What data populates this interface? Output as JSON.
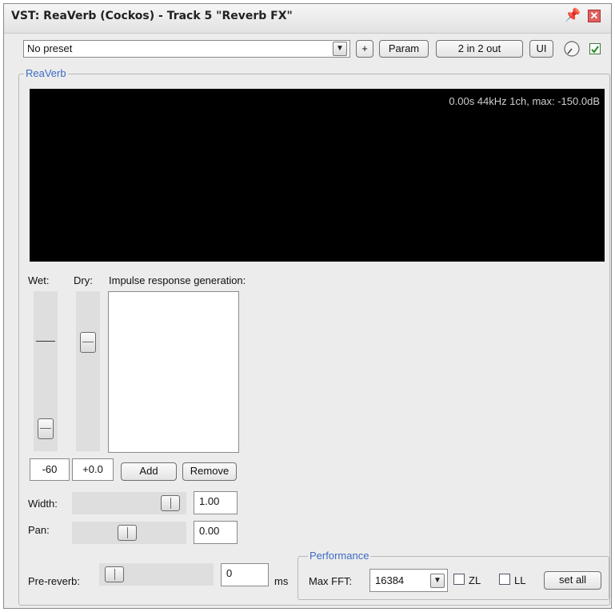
{
  "window": {
    "title": "VST: ReaVerb (Cockos) - Track 5 \"Reverb FX\""
  },
  "toolbar": {
    "preset_value": "No preset",
    "add_preset_label": "+",
    "param_label": "Param",
    "io_label": "2 in 2 out",
    "ui_label": "UI"
  },
  "plugin": {
    "group_title": "ReaVerb",
    "display_info": "0.00s 44kHz 1ch, max: -150.0dB",
    "wet_label": "Wet:",
    "dry_label": "Dry:",
    "ir_label": "Impulse response generation:",
    "wet_value": "-60",
    "dry_value": "+0.0",
    "add_label": "Add",
    "remove_label": "Remove",
    "width_label": "Width:",
    "width_value": "1.00",
    "pan_label": "Pan:",
    "pan_value": "0.00",
    "prereverb_label": "Pre-reverb:",
    "prereverb_value": "0",
    "prereverb_unit": "ms"
  },
  "performance": {
    "group_title": "Performance",
    "max_fft_label": "Max FFT:",
    "max_fft_value": "16384",
    "zl_label": "ZL",
    "ll_label": "LL",
    "set_all_label": "set all"
  },
  "colors": {
    "accent": "#3b6bc4",
    "display_bg": "#000000",
    "display_text": "#cfcfcf"
  }
}
